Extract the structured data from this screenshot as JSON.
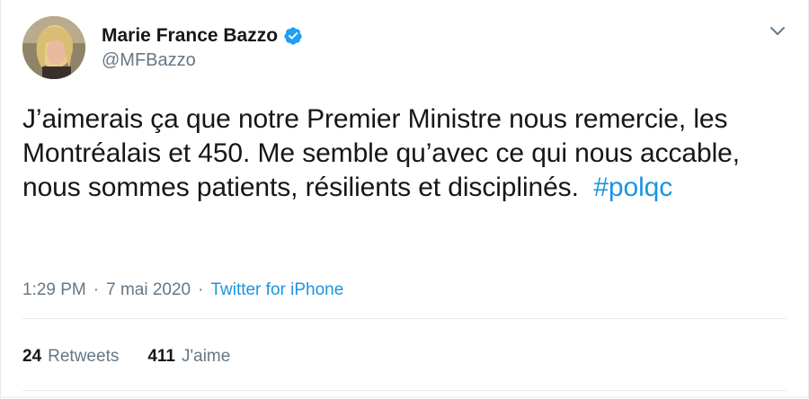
{
  "tweet": {
    "author": {
      "display_name": "Marie France Bazzo",
      "handle": "@MFBazzo",
      "verified": true
    },
    "text": "J’aimerais ça que notre Premier Ministre nous remercie, les Montréalais et 450. Me semble qu’avec ce qui nous accable, nous sommes patients, résilients et disciplinés.",
    "hashtag": "#polqc",
    "time": "1:29 PM",
    "date": "7 mai 2020",
    "separator": "·",
    "source": "Twitter for iPhone",
    "stats": {
      "retweets_count": "24",
      "retweets_label": "Retweets",
      "likes_count": "411",
      "likes_label": "J'aime"
    }
  },
  "icons": {
    "verified": "verified-badge-icon",
    "chevron": "chevron-down-icon"
  },
  "colors": {
    "link": "#1b95e0",
    "secondary_text": "#657786",
    "primary_text": "#14171a",
    "verified": "#1da1f2",
    "divider": "#e6ecf0"
  }
}
